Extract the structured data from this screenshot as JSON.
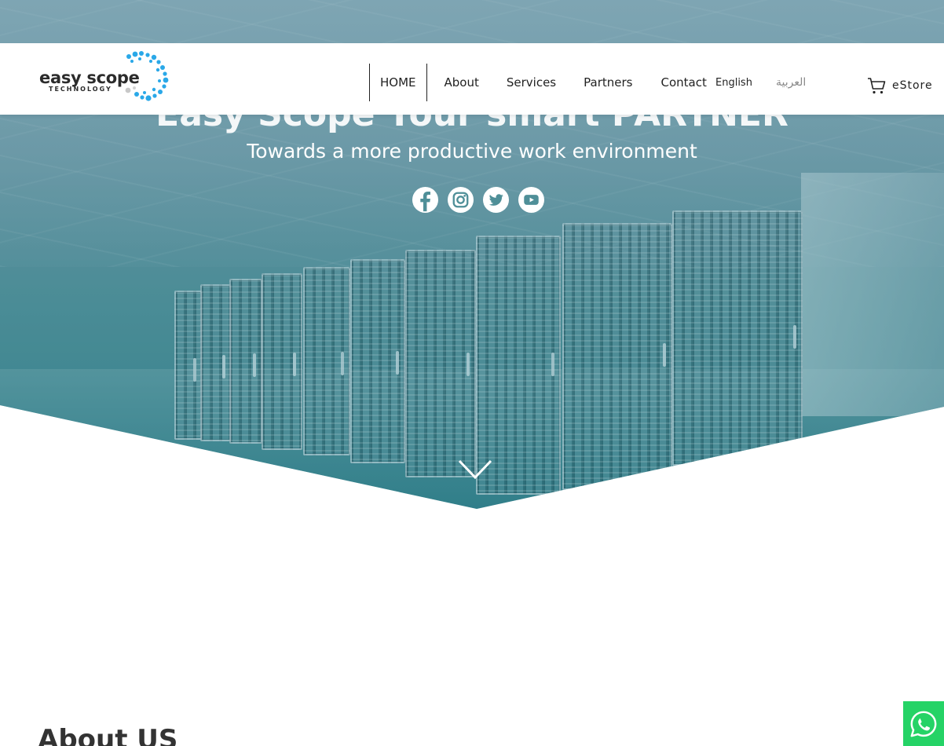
{
  "header": {
    "logo": {
      "name": "easy scope",
      "tagline": "TECHNOLOGY"
    },
    "nav": {
      "home": "HOME",
      "about": "About",
      "services": "Services",
      "partners": "Partners",
      "contact": "Contact"
    },
    "languages": {
      "english": "English",
      "arabic": "العربية"
    },
    "estore": {
      "label": "eStore",
      "icon": "cart-icon"
    }
  },
  "hero": {
    "title": "Easy Scope Your smart PARTNER",
    "subtitle": "Towards a more productive work environment",
    "social_icons": [
      "facebook-icon",
      "instagram-icon",
      "twitter-icon",
      "youtube-icon"
    ],
    "scroll_icon": "chevron-down-icon"
  },
  "about": {
    "heading": "About US"
  },
  "chat": {
    "icon": "whatsapp-icon",
    "color": "#25d366"
  },
  "colors": {
    "hero_tint": "#4f8f98",
    "logo_accent": "#2aa8e8",
    "text_dark": "#222222"
  }
}
